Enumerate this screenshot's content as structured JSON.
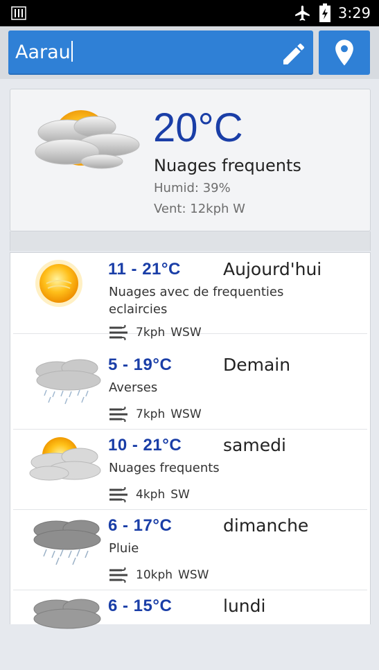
{
  "status_bar": {
    "time": "3:29",
    "icons": [
      "sim-icon",
      "airplane-mode-icon",
      "battery-icon"
    ]
  },
  "search": {
    "value": "Aarau",
    "icons": [
      "edit-pencil-icon",
      "location-pin-icon"
    ]
  },
  "current": {
    "temperature": "20°C",
    "condition": "Nuages frequents",
    "humidity": "Humid: 39%",
    "wind": "Vent: 12kph W",
    "icon": "sun-behind-clouds-icon"
  },
  "forecast": [
    {
      "range": "11 - 21°C",
      "day": "Aujourd'hui",
      "desc": "Nuages avec de frequenties eclaircies",
      "wind_speed": "7kph",
      "wind_dir": "WSW",
      "icon": "sun-icon"
    },
    {
      "range": "5 - 19°C",
      "day": "Demain",
      "desc": "Averses",
      "wind_speed": "7kph",
      "wind_dir": "WSW",
      "icon": "rain-showers-icon"
    },
    {
      "range": "10 - 21°C",
      "day": "samedi",
      "desc": "Nuages frequents",
      "wind_speed": "4kph",
      "wind_dir": "SW",
      "icon": "sun-behind-clouds-icon"
    },
    {
      "range": "6 - 17°C",
      "day": "dimanche",
      "desc": "Pluie",
      "wind_speed": "10kph",
      "wind_dir": "WSW",
      "icon": "rain-icon"
    },
    {
      "range": "6 - 15°C",
      "day": "lundi",
      "desc": "",
      "wind_speed": "",
      "wind_dir": "",
      "icon": "cloud-icon"
    }
  ],
  "colors": {
    "accent": "#2f80d6",
    "temp_blue": "#1a3ea7",
    "status_bar": "#000000"
  }
}
